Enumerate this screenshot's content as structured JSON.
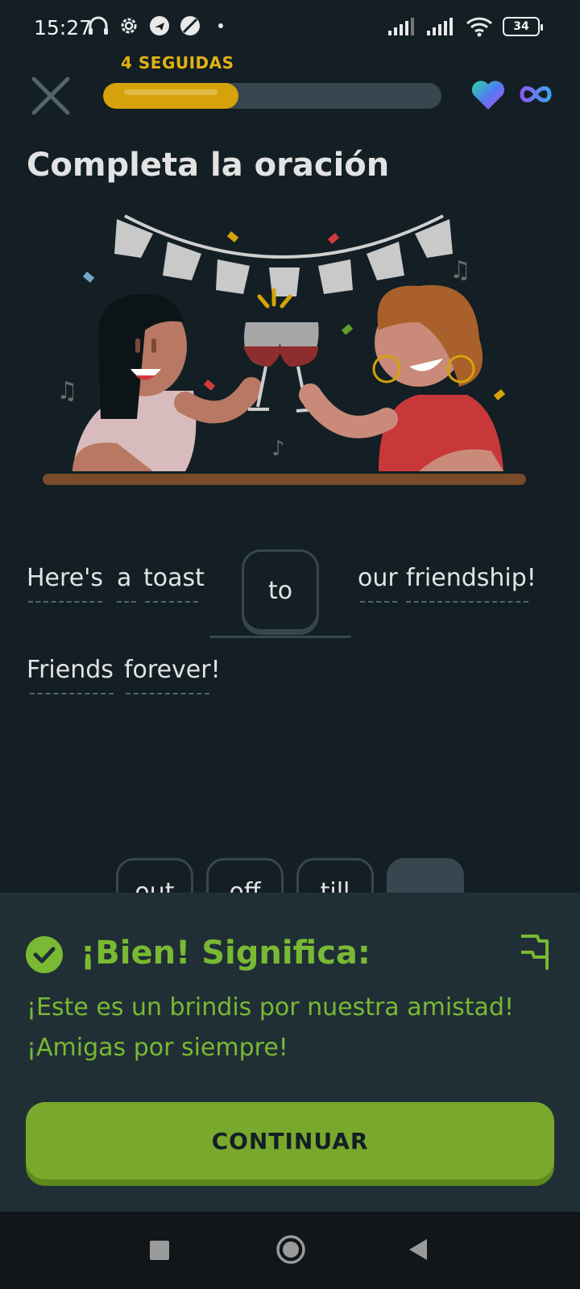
{
  "status_bar": {
    "time": "15:27",
    "battery": "34"
  },
  "header": {
    "streak_label": "4 SEGUIDAS",
    "progress_fraction": 0.4,
    "colors": {
      "progress": "#d6a209",
      "track": "#37464f"
    }
  },
  "exercise": {
    "title": "Completa la oración",
    "sentence": {
      "words_before": [
        "Here's",
        "a",
        "toast"
      ],
      "answer": "to",
      "words_after": [
        "our",
        "friendship!"
      ],
      "line2": [
        "Friends",
        "forever!"
      ]
    },
    "word_bank_partial": [
      "out",
      "off",
      "till"
    ]
  },
  "feedback": {
    "title": "¡Bien! Significa:",
    "text": "¡Este es un brindis por nuestra amistad! ¡Amigas por siempre!",
    "continue_label": "CONTINUAR",
    "colors": {
      "accent": "#79b933",
      "button": "#79a92c"
    }
  },
  "icons": {
    "close": "close-icon",
    "heart": "heart-icon",
    "infinity": "infinity-icon",
    "check": "check-circle-icon",
    "flag": "flag-icon"
  }
}
